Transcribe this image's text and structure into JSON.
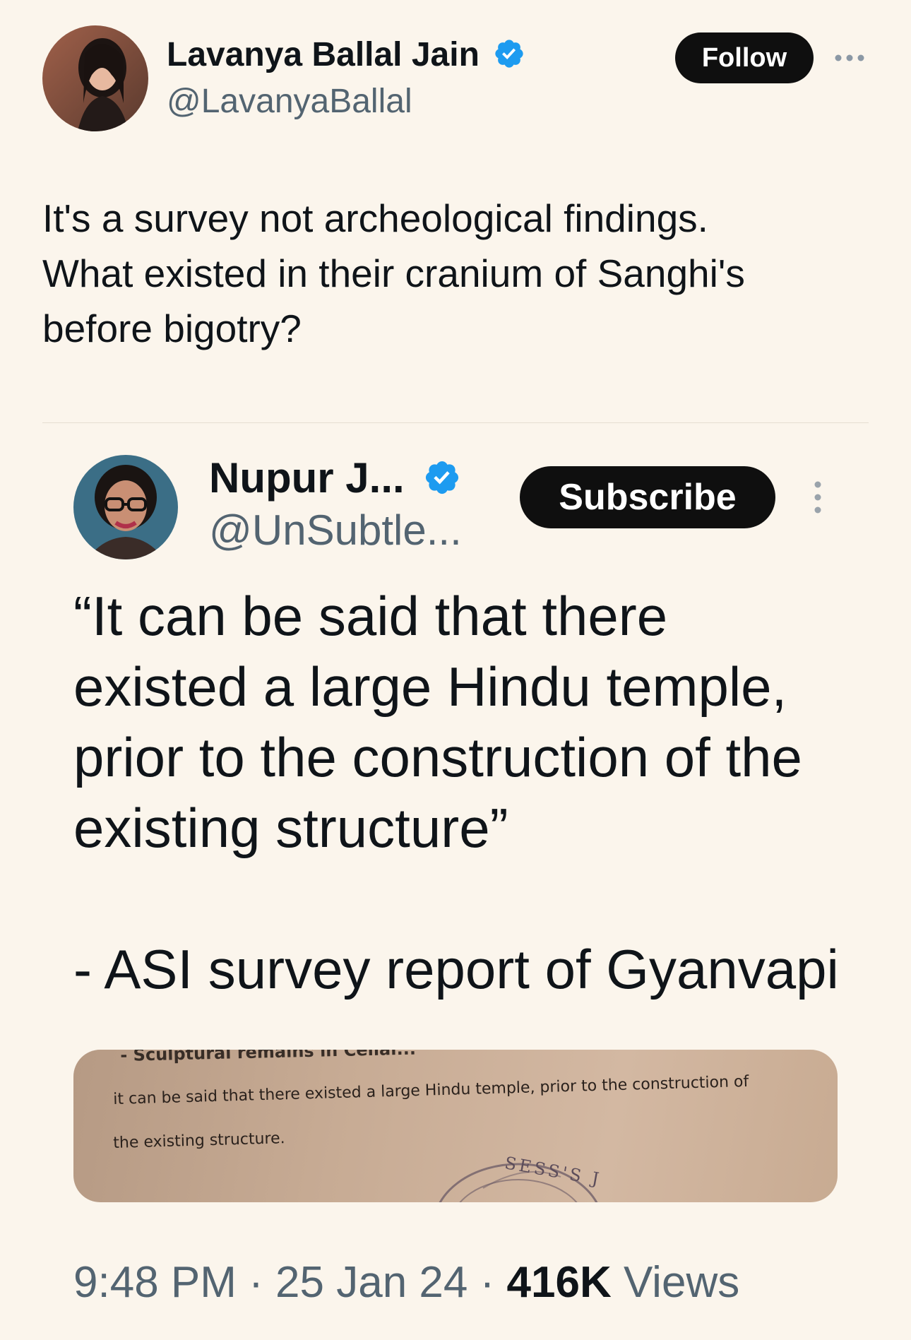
{
  "post": {
    "author_name": "Lavanya Ballal Jain",
    "author_handle": "@LavanyaBallal",
    "follow_label": "Follow",
    "more_icon": "more-horizontal-icon",
    "text_lines": [
      "It's a survey not archeological findings.",
      "What existed in their cranium of Sanghi's",
      "before bigotry?"
    ]
  },
  "quoted": {
    "author_name": "Nupur J...",
    "author_handle": "@UnSubtle...",
    "subscribe_label": "Subscribe",
    "more_icon": "more-vertical-icon",
    "text_lines": [
      "“It can be said that there",
      "existed a large Hindu temple,",
      "prior to the construction of the",
      "existing structure”"
    ],
    "attribution": "- ASI survey report of Gyanvapi",
    "image": {
      "top_line": "- Sculptural remains in Cellar...",
      "line1": "it can be said that there existed a large Hindu temple, prior to the construction of",
      "line2": "the existing structure.",
      "stamp_text": "SESS'S J"
    }
  },
  "meta": {
    "time": "9:48 PM",
    "separator": "·",
    "date": "25 Jan 24",
    "views_count": "416K",
    "views_label": "Views"
  },
  "colors": {
    "background": "#fbf5ec",
    "verified": "#1d9bf0",
    "button": "#0f0f0f",
    "secondary_text": "#536471"
  }
}
